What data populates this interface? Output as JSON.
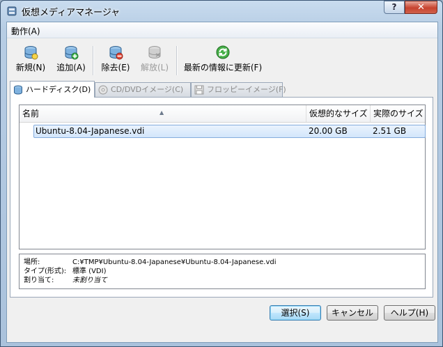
{
  "window": {
    "title": "仮想メディアマネージャ",
    "help_label": "?",
    "close_label": "✕"
  },
  "menu": {
    "action_label": "動作(A)"
  },
  "toolbar": {
    "new_label": "新規(N)",
    "add_label": "追加(A)",
    "remove_label": "除去(E)",
    "release_label": "解放(L)",
    "refresh_label": "最新の情報に更新(F)"
  },
  "tabs": [
    {
      "label": "ハードディスク(D)",
      "active": true
    },
    {
      "label": "CD/DVDイメージ(C)",
      "active": false
    },
    {
      "label": "フロッピーイメージ(F)",
      "active": false
    }
  ],
  "table": {
    "headers": {
      "name": "名前",
      "virtual_size": "仮想的なサイズ",
      "actual_size": "実際のサイズ"
    },
    "rows": [
      {
        "name": "Ubuntu-8.04-Japanese.vdi",
        "virtual_size": "20.00 GB",
        "actual_size": "2.51 GB",
        "selected": true
      }
    ]
  },
  "details": {
    "location_label": "場所:",
    "location_value": "C:¥TMP¥Ubuntu-8.04-Japanese¥Ubuntu-8.04-Japanese.vdi",
    "type_label": "タイプ(形式):",
    "type_value": "標準 (VDI)",
    "attached_label": "割り当て:",
    "attached_value": "未割り当て"
  },
  "buttons": {
    "select_label": "選択(S)",
    "cancel_label": "キャンセル",
    "help_label": "ヘルプ(H)"
  },
  "colors": {
    "selection_border": "#84acdd",
    "selection_fill": "#d3e6fb",
    "title_bar": "#b7cde4"
  }
}
